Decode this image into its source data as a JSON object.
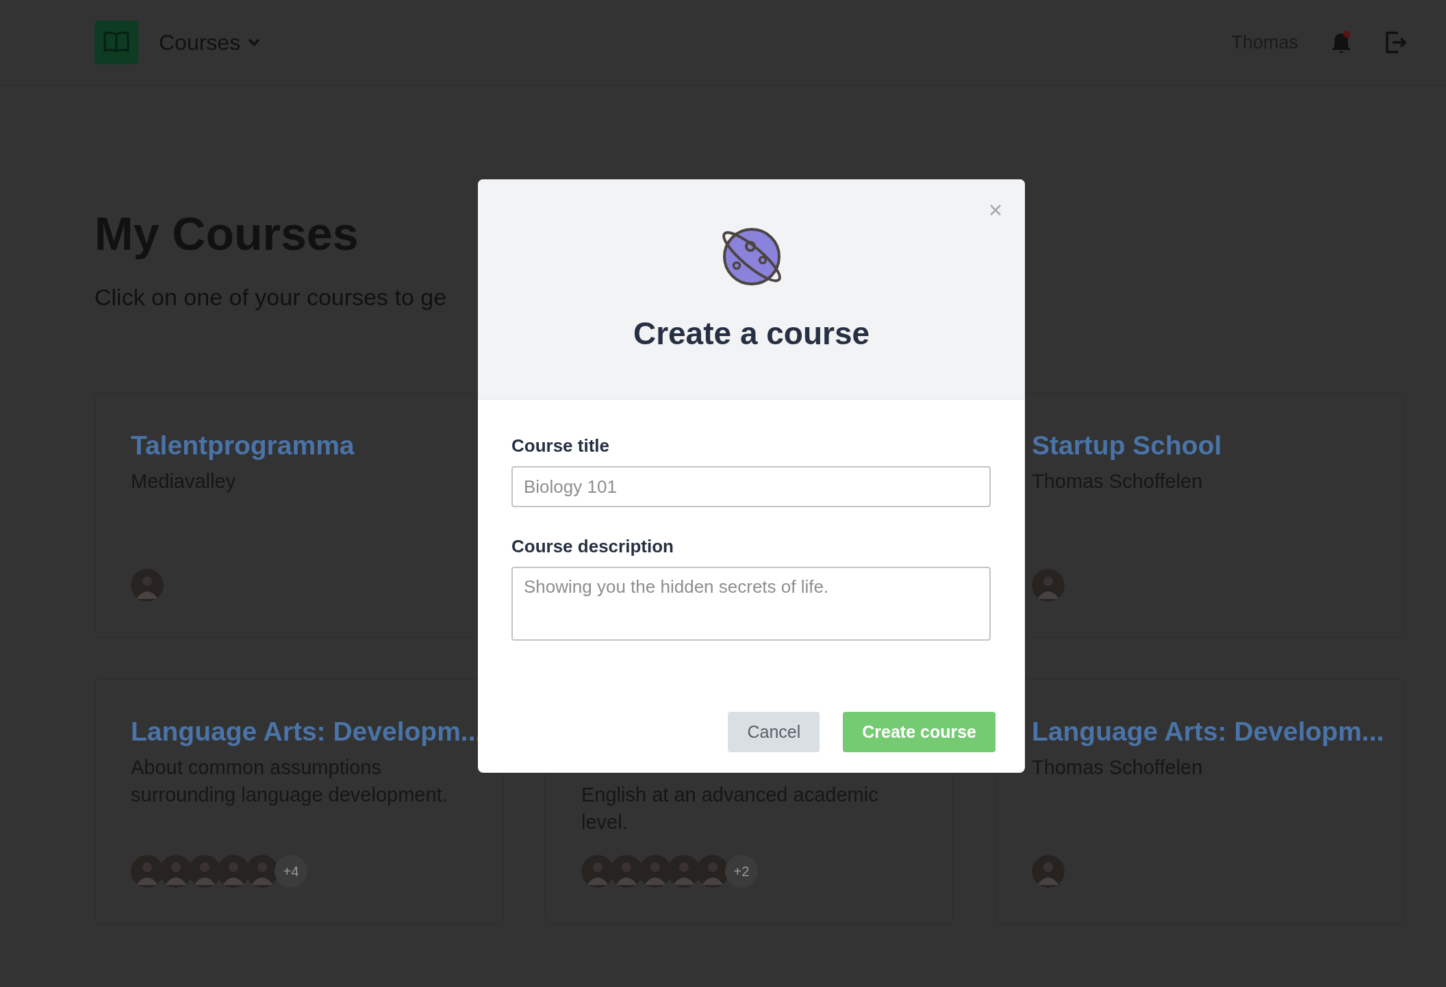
{
  "header": {
    "menu": "Courses",
    "user": "Thomas",
    "notifications": {
      "unread": true
    }
  },
  "page": {
    "title": "My Courses",
    "subtitle": "Click on one of your courses to ge"
  },
  "course_rows": [
    {
      "left": {
        "title": "Talentprogramma",
        "subtitle": "Mediavalley"
      },
      "right": {
        "title": "Startup School",
        "subtitle": "Thomas Schoffelen"
      }
    },
    {
      "left": {
        "title": "Language Arts: Developm...",
        "subtitle": "About common assumptions surrounding language development.",
        "more": "+4"
      },
      "middle": {
        "subtitle": "English at an advanced academic level.",
        "more": "+2"
      },
      "right": {
        "title": "Language Arts: Developm...",
        "subtitle": "Thomas Schoffelen"
      }
    }
  ],
  "modal": {
    "title": "Create a course",
    "fields": [
      {
        "kind": "input",
        "label": "Course title",
        "placeholder": "Biology 101"
      },
      {
        "kind": "textarea",
        "label": "Course description",
        "placeholder": "Showing you the hidden secrets of life."
      }
    ],
    "buttons": [
      {
        "kind": "secondary",
        "label": "Cancel"
      },
      {
        "kind": "primary",
        "label": "Create course"
      }
    ]
  }
}
